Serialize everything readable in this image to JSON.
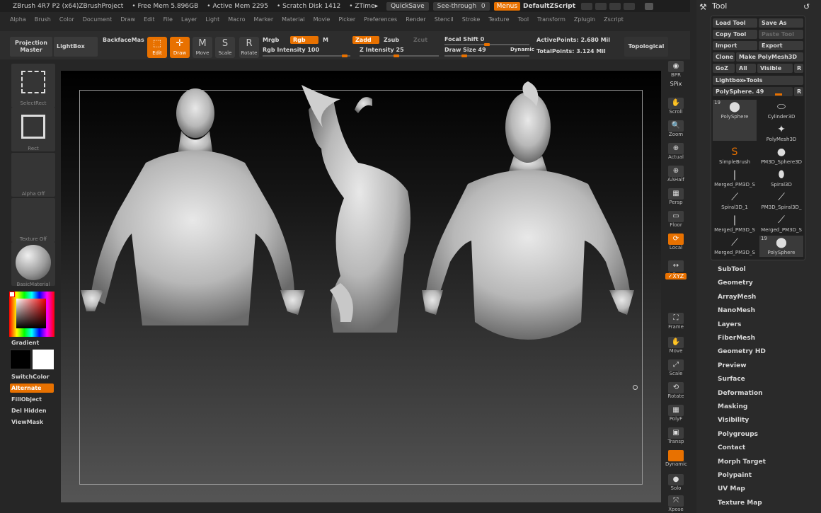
{
  "titlebar": {
    "app": "ZBrush 4R7 P2 (x64)ZBrushProject",
    "free_mem": "• Free Mem 5.896GB",
    "active_mem": "• Active Mem 2295",
    "scratch": "• Scratch Disk 1412",
    "ztime": "• ZTime▸",
    "quicksave": "QuickSave",
    "seethrough": "See-through",
    "seethrough_val": "0",
    "menus": "Menus",
    "zscript": "DefaultZScript"
  },
  "menubar": [
    "Alpha",
    "Brush",
    "Color",
    "Document",
    "Draw",
    "Edit",
    "File",
    "Layer",
    "Light",
    "Macro",
    "Marker",
    "Material",
    "Movie",
    "Picker",
    "Preferences",
    "Render",
    "Stencil",
    "Stroke",
    "Texture",
    "Tool",
    "Transform",
    "Zplugin",
    "Zscript"
  ],
  "shelf": {
    "projection_master": "Projection Master",
    "lightbox": "LightBox",
    "backface": "BackfaceMas",
    "edit": "Edit",
    "draw": "Draw",
    "move": "Move",
    "scale": "Scale",
    "rotate": "Rotate",
    "mrgb": "Mrgb",
    "rgb": "Rgb",
    "m": "M",
    "rgb_intensity": "Rgb Intensity 100",
    "zadd": "Zadd",
    "zsub": "Zsub",
    "zcut": "Zcut",
    "z_intensity": "Z Intensity 25",
    "focal_shift": "Focal Shift 0",
    "draw_size": "Draw Size 49",
    "dynamic": "Dynamic",
    "active_points": "ActivePoints: 2.680 Mil",
    "total_points": "TotalPoints: 3.124 Mil",
    "topological": "Topological"
  },
  "left": {
    "select_rect": "SelectRect",
    "rect": "Rect",
    "alpha_off": "Alpha Off",
    "texture_off": "Texture Off",
    "basic_material": "BasicMaterial",
    "gradient": "Gradient",
    "switchcolor": "SwitchColor",
    "alternate": "Alternate",
    "fillobject": "FillObject",
    "del_hidden": "Del Hidden",
    "viewmask": "ViewMask"
  },
  "righttools": {
    "bpr": "BPR",
    "spix": "SPix",
    "scroll": "Scroll",
    "zoom": "Zoom",
    "actual": "Actual",
    "aahalf": "AAHalf",
    "persp": "Persp",
    "floor": "Floor",
    "local": "Local",
    "lsym": "L.Sym",
    "xyz": "✓XYZ",
    "frame": "Frame",
    "move": "Move",
    "scale": "Scale",
    "rotate": "Rotate",
    "polyf": "PolyF",
    "transp": "Transp",
    "dynamic": "Dynamic",
    "solo": "Solo",
    "xpose": "Xpose"
  },
  "tool": {
    "title": "Tool",
    "load": "Load Tool",
    "save_as": "Save As",
    "copy": "Copy Tool",
    "paste": "Paste Tool",
    "import": "Import",
    "export": "Export",
    "clone": "Clone",
    "make_polymesh": "Make PolyMesh3D",
    "goz": "GoZ",
    "all": "All",
    "visible": "Visible",
    "r": "R",
    "lightbox_tools": "Lightbox▸Tools",
    "current": "PolySphere. 49",
    "items": [
      {
        "name": "PolySphere",
        "badge": "19"
      },
      {
        "name": "Cylinder3D",
        "badge": ""
      },
      {
        "name": "PolyMesh3D",
        "badge": ""
      },
      {
        "name": "SimpleBrush",
        "badge": ""
      },
      {
        "name": "PM3D_Sphere3D",
        "badge": ""
      },
      {
        "name": "Merged_PM3D_S",
        "badge": ""
      },
      {
        "name": "Spiral3D",
        "badge": ""
      },
      {
        "name": "Spiral3D_1",
        "badge": ""
      },
      {
        "name": "PM3D_Spiral3D_",
        "badge": ""
      },
      {
        "name": "Merged_PM3D_S",
        "badge": ""
      },
      {
        "name": "Merged_PM3D_S",
        "badge": ""
      },
      {
        "name": "Merged_PM3D_S",
        "badge": ""
      },
      {
        "name": "PolySphere",
        "badge": "19"
      }
    ],
    "subpalettes": [
      "SubTool",
      "Geometry",
      "ArrayMesh",
      "NanoMesh",
      "Layers",
      "FiberMesh",
      "Geometry HD",
      "Preview",
      "Surface",
      "Deformation",
      "Masking",
      "Visibility",
      "Polygroups",
      "Contact",
      "Morph Target",
      "Polypaint",
      "UV Map",
      "Texture Map"
    ]
  }
}
